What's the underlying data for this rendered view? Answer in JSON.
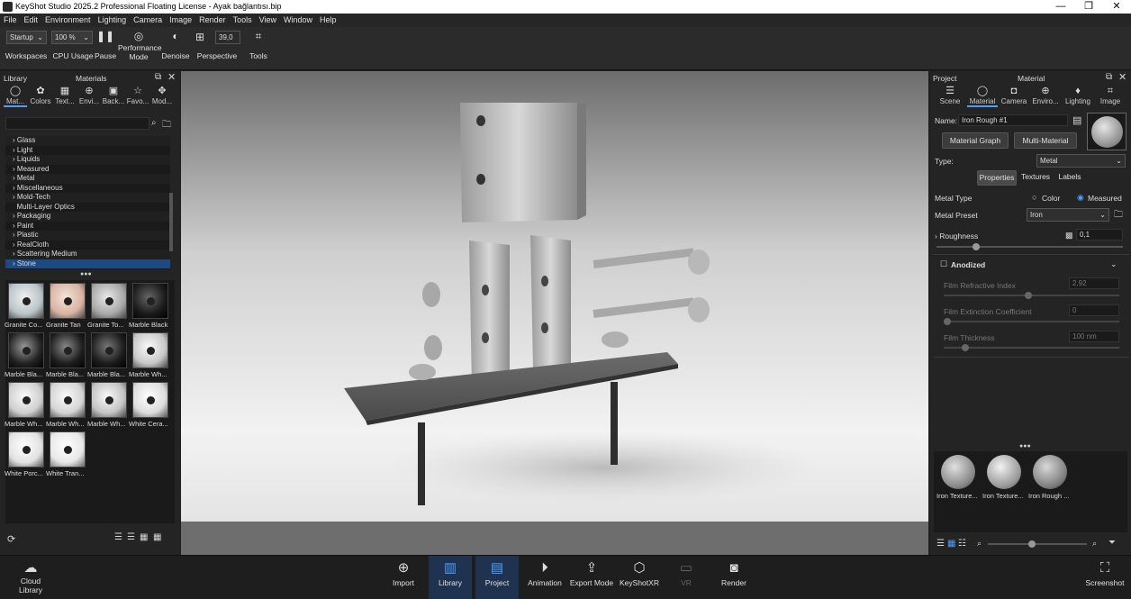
{
  "window": {
    "title": "KeyShot Studio 2025.2 Professional Floating License  - Ayak bağlantısı.bip",
    "minimize": "—",
    "maximize": "❐",
    "close": "✕"
  },
  "menu": [
    "File",
    "Edit",
    "Environment",
    "Lighting",
    "Camera",
    "Image",
    "Render",
    "Tools",
    "View",
    "Window",
    "Help"
  ],
  "toolbar": {
    "workspace_value": "Startup",
    "workspaces_label": "Workspaces",
    "cpu_value": "100 %",
    "cpu_label": "CPU Usage",
    "pause_label": "Pause",
    "performance_label": "Performance Mode",
    "denoise_label": "Denoise",
    "fov_value": "39,0",
    "perspective_label": "Perspective",
    "tools_label": "Tools"
  },
  "library": {
    "header_left": "Library",
    "header_center": "Materials",
    "tabs": [
      "Mat...",
      "Colors",
      "Text...",
      "Envi...",
      "Back...",
      "Favo...",
      "Mod..."
    ],
    "search_placeholder": "",
    "tree": [
      "Glass",
      "Light",
      "Liquids",
      "Measured",
      "Metal",
      "Miscellaneous",
      "Mold-Tech",
      "Multi-Layer Optics",
      "Packaging",
      "Paint",
      "Plastic",
      "RealCloth",
      "Scattering Medium",
      "Stone"
    ],
    "swatches": [
      "Granite Co...",
      "Granite Tan",
      "Granite To...",
      "Marble Black",
      "Marble Bla...",
      "Marble Bla...",
      "Marble Bla...",
      "Marble Wh...",
      "Marble Wh...",
      "Marble Wh...",
      "Marble Wh...",
      "White Cera...",
      "White Porc...",
      "White Tran..."
    ],
    "dots": "●●●"
  },
  "project": {
    "header_left": "Project",
    "header_center": "Material",
    "tabs": [
      "Scene",
      "Material",
      "Camera",
      "Enviro...",
      "Lighting",
      "Image"
    ],
    "name_label": "Name:",
    "name_value": "Iron Rough #1",
    "material_graph": "Material Graph",
    "multi_material": "Multi-Material",
    "type_label": "Type:",
    "type_value": "Metal",
    "subtabs": [
      "Properties",
      "Textures",
      "Labels"
    ],
    "metal_type_label": "Metal Type",
    "metal_type_color": "Color",
    "metal_type_measured": "Measured",
    "metal_preset_label": "Metal Preset",
    "metal_preset_value": "Iron",
    "roughness_label": "Roughness",
    "roughness_value": "0,1",
    "roughness_level": 0.1,
    "anodized_label": "Anodized",
    "film_ri_label": "Film Refractive Index",
    "film_ri_value": "2,92",
    "film_ec_label": "Film Extinction Coefficient",
    "film_ec_value": "0",
    "film_thick_label": "Film Thickness",
    "film_thick_value": "100 nm",
    "dots": "●●●",
    "thumbs": [
      "Iron Texture...",
      "Iron Texture...",
      "Iron Rough ..."
    ]
  },
  "bottom": {
    "cloud_library": "Cloud Library",
    "import": "Import",
    "library": "Library",
    "project": "Project",
    "animation": "Animation",
    "export_mode": "Export Mode",
    "keyshotxr": "KeyShotXR",
    "vr": "VR",
    "render": "Render",
    "screenshot": "Screenshot"
  }
}
